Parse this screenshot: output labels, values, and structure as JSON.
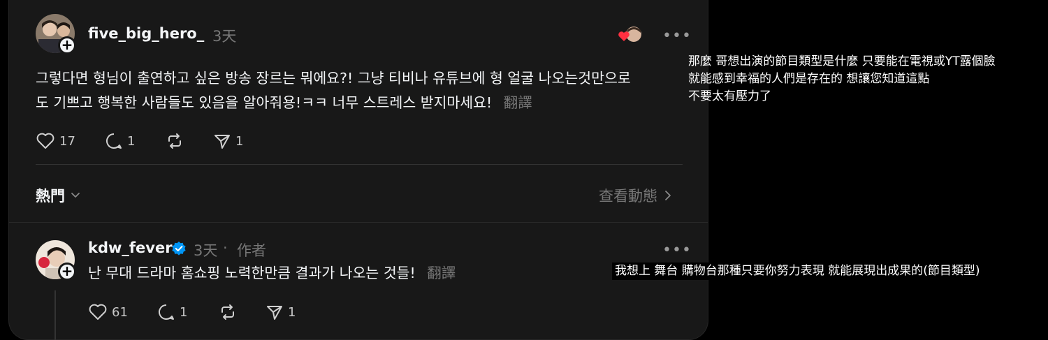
{
  "post": {
    "username": "five_big_hero_",
    "time": "3天",
    "text_line1": "그렇다면 형님이 출연하고 싶은 방송 장르는 뭐에요?! 그냥 티비나 유튜브에 형 얼굴 나오는것만으로",
    "text_line2": "도 기쁘고 행복한 사람들도 있음을 알아줘용!ㅋㅋ 너무 스트레스 받지마세요!",
    "translate_label": "翻譯",
    "likes": "17",
    "replies": "1",
    "shares": "1"
  },
  "section": {
    "label": "熱門",
    "view_activity": "查看動態"
  },
  "reply": {
    "username": "kdw_fever",
    "time": "3天",
    "author_tag": "作者",
    "separator": "·",
    "text": "난 무대 드라마 홈쇼핑 노력한만큼 결과가 나오는 것들!",
    "translate_label": "翻譯",
    "likes": "61",
    "replies": "1",
    "shares": "1"
  },
  "annotations": {
    "translation1_line1": "那麼 哥想出演的節目類型是什麼 只要能在電視或YT露個臉",
    "translation1_line2": "就能感到幸福的人們是存在的 想讓您知道這點",
    "translation1_line3": "不要太有壓力了",
    "translation2": "我想上 舞台 購物台那種只要你努力表現 就能展現出成果的(節目類型)"
  },
  "colors": {
    "background": "#000000",
    "card": "#181818",
    "muted_text": "#777777",
    "verified_blue": "#0095f6",
    "heart_red": "#ff3040"
  },
  "icons": [
    "heart-icon",
    "comment-icon",
    "repost-icon",
    "share-icon",
    "more-icon",
    "plus-icon",
    "verified-icon",
    "chevron-down-icon",
    "chevron-right-icon"
  ]
}
